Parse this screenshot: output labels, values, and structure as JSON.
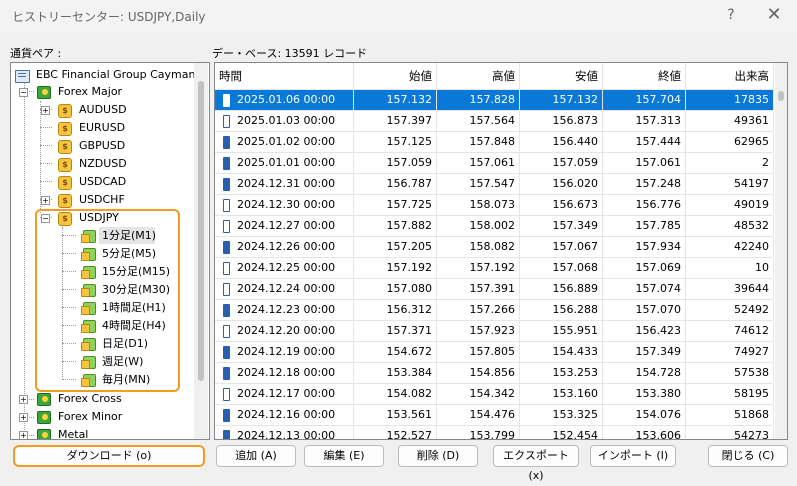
{
  "window": {
    "title": "ヒストリーセンター: USDJPY,Daily",
    "help_symbol": "?",
    "close_symbol": "✕"
  },
  "labels": {
    "pairs": "通貨ペア :",
    "database": "デー・ベース: 13591 レコード"
  },
  "tree": {
    "root": "EBC Financial Group Cayman M",
    "forex_major": "Forex Major",
    "symbols": [
      "AUDUSD",
      "EURUSD",
      "GBPUSD",
      "NZDUSD",
      "USDCAD",
      "USDCHF"
    ],
    "expanded_symbol": "USDJPY",
    "timeframes": [
      "1分足(M1)",
      "5分足(M5)",
      "15分足(M15)",
      "30分足(M30)",
      "1時間足(H1)",
      "4時間足(H4)",
      "日足(D1)",
      "週足(W)",
      "毎月(MN)"
    ],
    "groups": [
      "Forex Cross",
      "Forex Minor",
      "Metal"
    ],
    "highlight_color": "#f59a23"
  },
  "table": {
    "columns": [
      "時間",
      "始値",
      "高値",
      "安値",
      "終値",
      "出来高"
    ],
    "rows": [
      [
        "2025.01.06 00:00",
        "157.132",
        "157.828",
        "157.132",
        "157.704",
        "17835"
      ],
      [
        "2025.01.03 00:00",
        "157.397",
        "157.564",
        "156.873",
        "157.313",
        "49361"
      ],
      [
        "2025.01.02 00:00",
        "157.125",
        "157.848",
        "156.440",
        "157.444",
        "62965"
      ],
      [
        "2025.01.01 00:00",
        "157.059",
        "157.061",
        "157.059",
        "157.061",
        "2"
      ],
      [
        "2024.12.31 00:00",
        "156.787",
        "157.547",
        "156.020",
        "157.248",
        "54197"
      ],
      [
        "2024.12.30 00:00",
        "157.725",
        "158.073",
        "156.673",
        "156.776",
        "49019"
      ],
      [
        "2024.12.27 00:00",
        "157.882",
        "158.002",
        "157.349",
        "157.785",
        "48532"
      ],
      [
        "2024.12.26 00:00",
        "157.205",
        "158.082",
        "157.067",
        "157.934",
        "42240"
      ],
      [
        "2024.12.25 00:00",
        "157.192",
        "157.192",
        "157.068",
        "157.069",
        "10"
      ],
      [
        "2024.12.24 00:00",
        "157.080",
        "157.391",
        "156.889",
        "157.074",
        "39644"
      ],
      [
        "2024.12.23 00:00",
        "156.312",
        "157.266",
        "156.288",
        "157.070",
        "52492"
      ],
      [
        "2024.12.20 00:00",
        "157.371",
        "157.923",
        "155.951",
        "156.423",
        "74612"
      ],
      [
        "2024.12.19 00:00",
        "154.672",
        "157.805",
        "154.433",
        "157.349",
        "74927"
      ],
      [
        "2024.12.18 00:00",
        "153.384",
        "154.856",
        "153.253",
        "154.728",
        "57538"
      ],
      [
        "2024.12.17 00:00",
        "154.082",
        "154.342",
        "153.160",
        "153.380",
        "58195"
      ],
      [
        "2024.12.16 00:00",
        "153.561",
        "154.476",
        "153.325",
        "154.076",
        "51868"
      ],
      [
        "2024.12.13 00:00",
        "152.527",
        "153.799",
        "152.454",
        "153.606",
        "54273"
      ]
    ],
    "selected_row": 0,
    "selection_color": "#0a78d7"
  },
  "buttons": {
    "download": "ダウンロード (o)",
    "add": "追加 (A)",
    "edit": "編集 (E)",
    "delete": "削除 (D)",
    "export": "エクスポート (x)",
    "import": "インポート (I)",
    "close": "閉じる (C)"
  }
}
